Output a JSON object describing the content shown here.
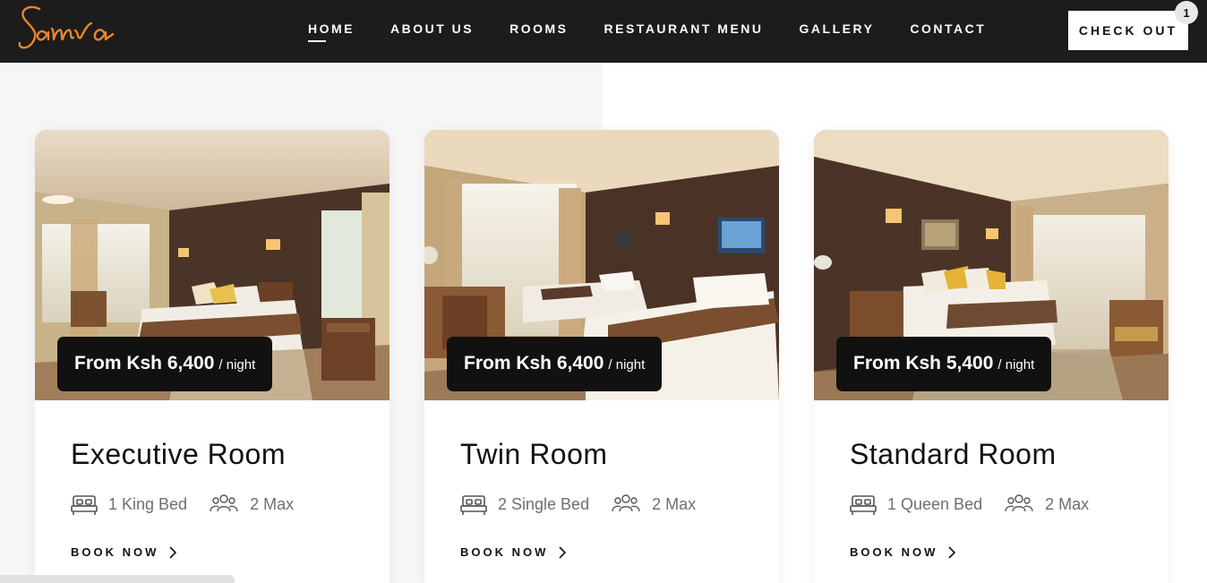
{
  "brand": {
    "logo_text": "Samra",
    "logo_color": "#e8862d"
  },
  "nav": {
    "items": [
      {
        "label": "HOME",
        "active": true
      },
      {
        "label": "ABOUT US",
        "active": false
      },
      {
        "label": "ROOMS",
        "active": false
      },
      {
        "label": "RESTAURANT MENU",
        "active": false
      },
      {
        "label": "GALLERY",
        "active": false
      },
      {
        "label": "CONTACT",
        "active": false
      }
    ]
  },
  "checkout": {
    "label": "CHECK OUT",
    "count": "1"
  },
  "rooms": [
    {
      "name": "Executive Room",
      "price": "From Ksh 6,400",
      "price_unit": "/ night",
      "beds": "1 King Bed",
      "max": "2 Max",
      "cta": "BOOK NOW"
    },
    {
      "name": "Twin Room",
      "price": "From Ksh 6,400",
      "price_unit": "/ night",
      "beds": "2 Single Bed",
      "max": "2 Max",
      "cta": "BOOK NOW"
    },
    {
      "name": "Standard Room",
      "price": "From Ksh 5,400",
      "price_unit": "/ night",
      "beds": "1 Queen Bed",
      "max": "2 Max",
      "cta": "BOOK NOW"
    }
  ],
  "icons": {
    "bed": "bed-icon",
    "guests": "guests-icon",
    "chevron": "chevron-right-icon"
  },
  "colors": {
    "header_bg": "#1c1c1c",
    "price_bg": "#111111",
    "text_muted": "#6e6e6e"
  }
}
